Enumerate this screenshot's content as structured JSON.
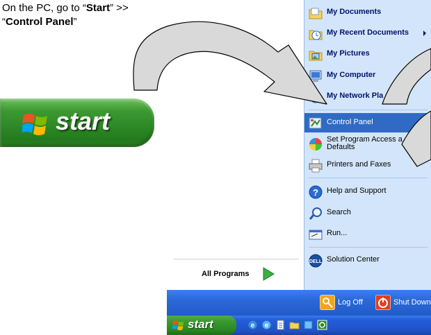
{
  "instruction": {
    "line1_prefix": "On the PC, go to “",
    "line1_bold": "Start",
    "line1_suffix": "” >>",
    "line2_prefix": "“",
    "line2_bold": "Control Panel",
    "line2_suffix": "”"
  },
  "big_start": {
    "label": "start",
    "icon": "windows-flag-icon"
  },
  "start_menu": {
    "right_items": [
      {
        "label": "My Documents",
        "icon": "folder-documents-icon"
      },
      {
        "label": "My Recent Documents",
        "icon": "recent-documents-icon"
      },
      {
        "label": "My Pictures",
        "icon": "pictures-icon"
      },
      {
        "label": "My Computer",
        "icon": "computer-icon"
      },
      {
        "label": "My Network Pla",
        "icon": "network-places-icon"
      },
      {
        "label": "Control Panel",
        "icon": "control-panel-icon"
      },
      {
        "label": "Set Program Access a Defaults",
        "line1": "Set Program Access a",
        "line2": "Defaults",
        "icon": "program-access-icon"
      },
      {
        "label": "Printers and Faxes",
        "icon": "printer-icon"
      },
      {
        "label": "Help and Support",
        "icon": "help-icon"
      },
      {
        "label": "Search",
        "icon": "search-icon"
      },
      {
        "label": "Run...",
        "icon": "run-icon"
      },
      {
        "label": "Solution Center",
        "icon": "dell-logo-icon"
      }
    ],
    "all_programs": "All Programs",
    "log_off": "Log Off",
    "shut_down": "Shut Down",
    "selected_item": "Control Panel"
  },
  "taskbar": {
    "start_label": "start"
  },
  "colors": {
    "menu_right_bg": "#d3e5fa",
    "selection": "#316ac5",
    "start_green": "#2f8a27",
    "bar_blue": "#245edb"
  }
}
